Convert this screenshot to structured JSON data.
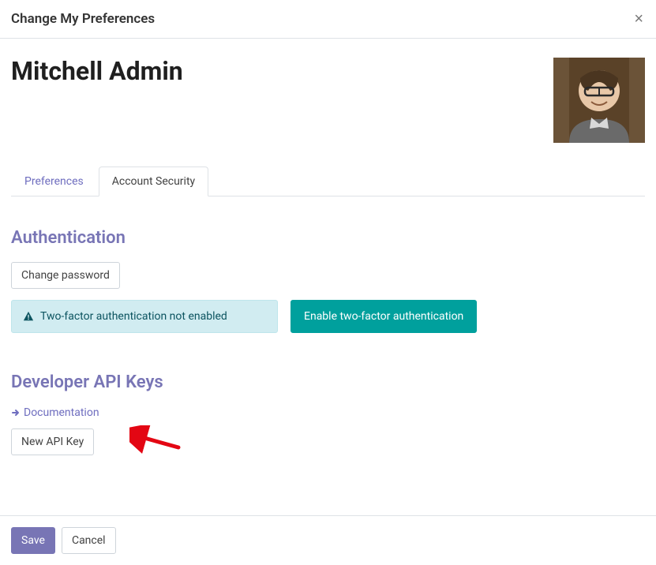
{
  "header": {
    "title": "Change My Preferences"
  },
  "user": {
    "name": "Mitchell Admin"
  },
  "tabs": {
    "preferences": "Preferences",
    "account_security": "Account Security"
  },
  "auth": {
    "section_title": "Authentication",
    "change_password": "Change password",
    "two_fa_note": "Two-factor authentication not enabled",
    "enable_two_fa": "Enable two-factor authentication"
  },
  "dev": {
    "section_title": "Developer API Keys",
    "doc_link": "Documentation",
    "new_key": "New API Key"
  },
  "footer": {
    "save": "Save",
    "cancel": "Cancel"
  }
}
